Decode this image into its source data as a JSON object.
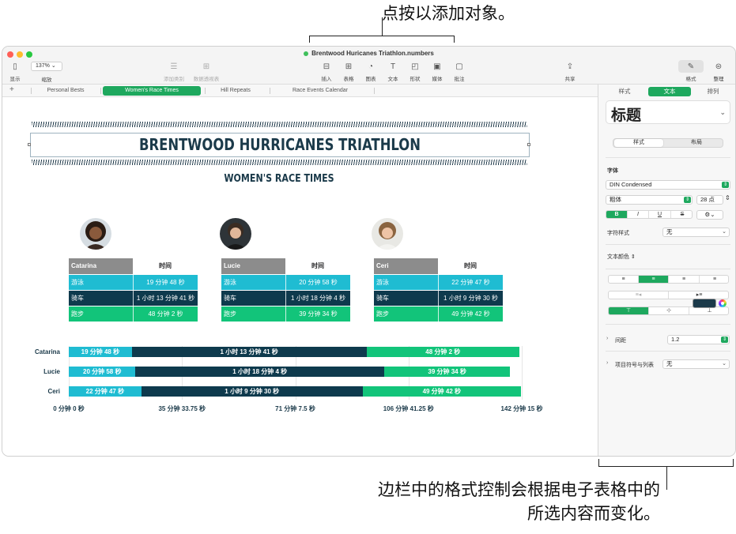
{
  "callouts": {
    "top": "点按以添加对象。",
    "bottom_line1": "边栏中的格式控制会根据电子表格中的",
    "bottom_line2": "所选内容而变化。"
  },
  "window": {
    "title": "Brentwood Huricanes Triathlon.numbers",
    "traffic_colors": [
      "#ff5f57",
      "#febc2e",
      "#28c840"
    ]
  },
  "toolbar": {
    "view_label": "显示",
    "zoom_value": "137%",
    "zoom_label": "缩放",
    "add_category_label": "添加类别",
    "pivot_table_label": "数据透视表",
    "insert_label": "插入",
    "table_label": "表格",
    "chart_label": "图表",
    "text_label": "文本",
    "shape_label": "形状",
    "media_label": "媒体",
    "comment_label": "批注",
    "share_label": "共享",
    "format_label": "格式",
    "organize_label": "整理"
  },
  "sheet_tabs": [
    "Personal Bests",
    "Women's Race Times",
    "Hill Repeats",
    "Race Events Calendar"
  ],
  "active_sheet_index": 1,
  "document": {
    "title": "BRENTWOOD HURRICANES TRIATHLON",
    "subtitle": "WOMEN'S RACE TIMES",
    "time_column_header": "时间",
    "activities": [
      "游泳",
      "骑车",
      "跑步"
    ],
    "athletes": [
      {
        "name": "Catarina",
        "times": [
          "19 分钟 48 秒",
          "1 小时 13 分钟 41 秒",
          "48 分钟 2 秒"
        ]
      },
      {
        "name": "Lucie",
        "times": [
          "20 分钟 58 秒",
          "1 小时 18 分钟 4 秒",
          "39 分钟 34 秒"
        ]
      },
      {
        "name": "Ceri",
        "times": [
          "22 分钟 47 秒",
          "1 小时 9 分钟 30 秒",
          "49 分钟 42 秒"
        ]
      }
    ],
    "colors": {
      "swim": "#1fbcd2",
      "bike": "#0e3a4d",
      "run": "#12c47a",
      "header_gray": "#8c8c8c",
      "navy": "#1b3a4a"
    }
  },
  "chart_data": {
    "type": "bar",
    "stacked": true,
    "orientation": "horizontal",
    "categories": [
      "Catarina",
      "Lucie",
      "Ceri"
    ],
    "series": [
      {
        "values": [
          19.8,
          20.97,
          22.78
        ],
        "labels": [
          "19 分钟 48 秒",
          "20 分钟 58 秒",
          "22 分钟 47 秒"
        ],
        "color": "#1fbcd2"
      },
      {
        "values": [
          73.68,
          78.07,
          69.5
        ],
        "labels": [
          "1 小时 13 分钟 41 秒",
          "1 小时 18 分钟 4 秒",
          "1 小时 9 分钟 30 秒"
        ],
        "color": "#0e3a4d"
      },
      {
        "values": [
          48.03,
          39.57,
          49.7
        ],
        "labels": [
          "48 分钟 2 秒",
          "39 分钟 34 秒",
          "49 分钟 42 秒"
        ],
        "color": "#12c47a"
      }
    ],
    "x_range_minutes": [
      0,
      142.25
    ],
    "x_tick_labels": [
      "0 分钟 0 秒",
      "35 分钟 33.75 秒",
      "71 分钟 7.5 秒",
      "106 分钟 41.25 秒",
      "142 分钟 15 秒"
    ],
    "grid": true
  },
  "sidebar": {
    "tabs": [
      "样式",
      "文本",
      "排列"
    ],
    "active_tab_index": 1,
    "paragraph_style": "标题",
    "segment": [
      "样式",
      "布局"
    ],
    "font_section": "字体",
    "font_name": "DIN Condensed",
    "font_weight": "粗体",
    "font_size": "28 点",
    "bold": "B",
    "italic": "I",
    "underline": "U",
    "strikethrough": "S",
    "char_style_label": "字符样式",
    "char_style_value": "无",
    "text_color_label": "文本颜色",
    "text_color": "#1b3a4a",
    "spacing_label": "间距",
    "spacing_value": "1.2",
    "bullets_label": "项目符号与列表",
    "bullets_value": "无"
  }
}
